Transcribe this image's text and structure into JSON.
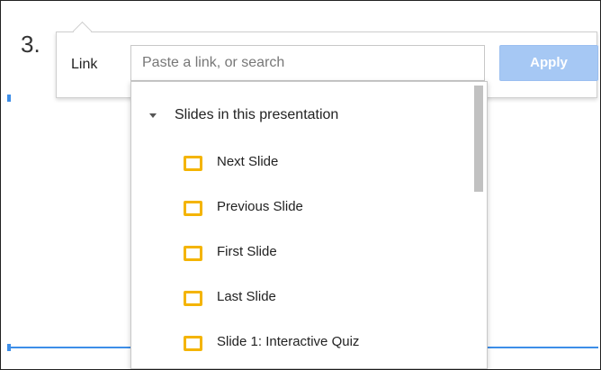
{
  "document": {
    "list_number": "3."
  },
  "link_dialog": {
    "label": "Link",
    "input_placeholder": "Paste a link, or search",
    "input_value": "",
    "apply_label": "Apply"
  },
  "dropdown": {
    "section_label": "Slides in this presentation",
    "items": [
      {
        "label": "Next Slide",
        "icon": "slide-icon"
      },
      {
        "label": "Previous Slide",
        "icon": "slide-icon"
      },
      {
        "label": "First Slide",
        "icon": "slide-icon"
      },
      {
        "label": "Last Slide",
        "icon": "slide-icon"
      },
      {
        "label": "Slide 1: Interactive Quiz",
        "icon": "slide-icon"
      }
    ]
  },
  "colors": {
    "apply_disabled": "#a6c8f4",
    "slide_icon": "#f4b400",
    "selection_guide": "#3d8ee8"
  }
}
